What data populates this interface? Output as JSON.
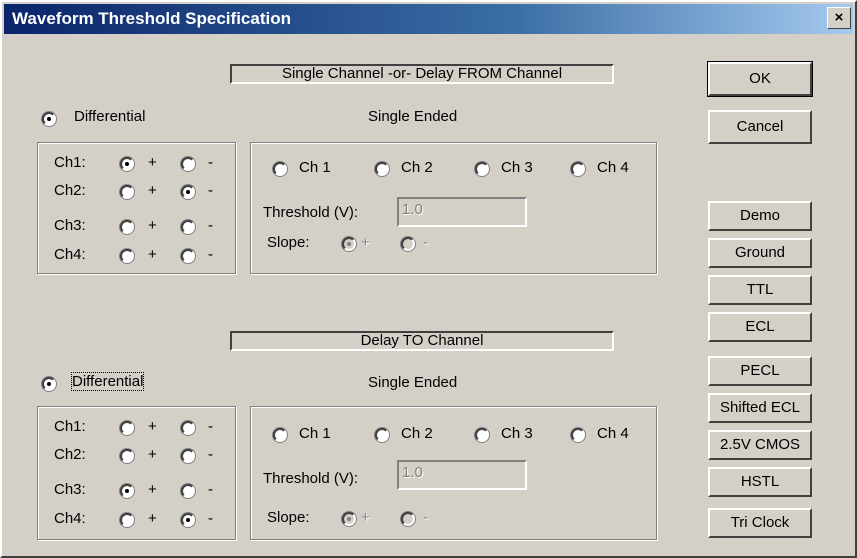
{
  "window": {
    "title": "Waveform Threshold Specification",
    "close_label": "×"
  },
  "section1": {
    "header": "Single Channel -or- Delay FROM Channel",
    "differential_label": "Differential",
    "single_ended_label": "Single Ended",
    "diff_rows": [
      {
        "label": "Ch1:",
        "plus": "+",
        "minus": "-"
      },
      {
        "label": "Ch2:",
        "plus": "+",
        "minus": "-"
      },
      {
        "label": "Ch3:",
        "plus": "+",
        "minus": "-"
      },
      {
        "label": "Ch4:",
        "plus": "+",
        "minus": "-"
      }
    ],
    "channels": [
      "Ch 1",
      "Ch 2",
      "Ch 3",
      "Ch 4"
    ],
    "threshold_label": "Threshold (V):",
    "threshold_value": "1.0",
    "slope_label": "Slope:",
    "slope_plus": "+",
    "slope_minus": "-"
  },
  "section2": {
    "header": "Delay TO Channel",
    "differential_label": "Differential",
    "single_ended_label": "Single Ended",
    "diff_rows": [
      {
        "label": "Ch1:",
        "plus": "+",
        "minus": "-"
      },
      {
        "label": "Ch2:",
        "plus": "+",
        "minus": "-"
      },
      {
        "label": "Ch3:",
        "plus": "+",
        "minus": "-"
      },
      {
        "label": "Ch4:",
        "plus": "+",
        "minus": "-"
      }
    ],
    "channels": [
      "Ch 1",
      "Ch 2",
      "Ch 3",
      "Ch 4"
    ],
    "threshold_label": "Threshold (V):",
    "threshold_value": "1.0",
    "slope_label": "Slope:",
    "slope_plus": "+",
    "slope_minus": "-"
  },
  "buttons": {
    "ok": "OK",
    "cancel": "Cancel",
    "demo": "Demo",
    "ground": "Ground",
    "ttl": "TTL",
    "ecl": "ECL",
    "pecl": "PECL",
    "shifted_ecl": "Shifted ECL",
    "cmos25": "2.5V CMOS",
    "hstl": "HSTL",
    "tri_clock": "Tri Clock"
  },
  "colors": {
    "titlebar_start": "#0a246a",
    "titlebar_end": "#a6caf0",
    "face": "#d4d0c8"
  }
}
